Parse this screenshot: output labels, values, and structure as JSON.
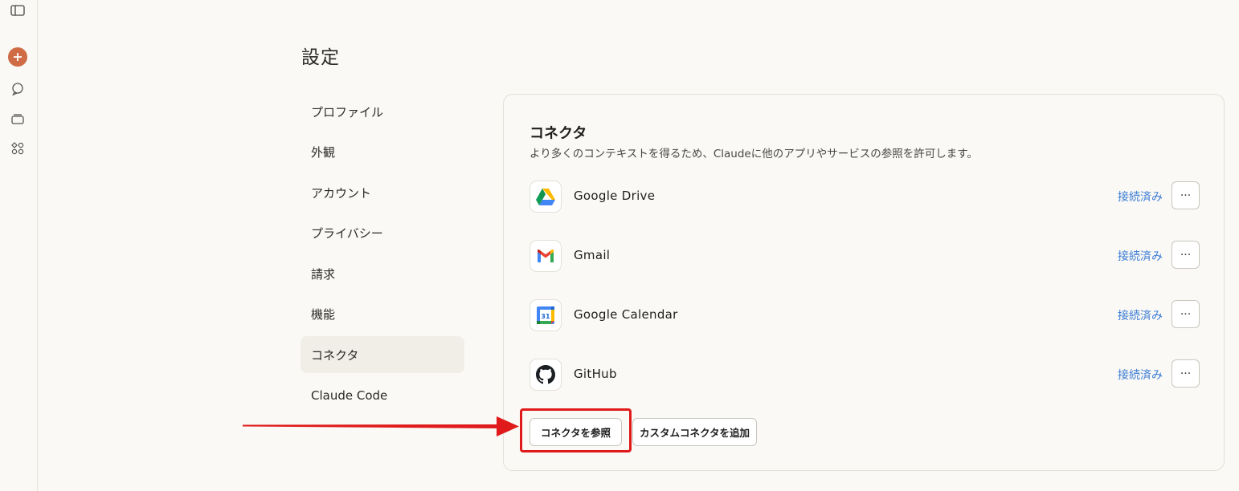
{
  "sidebar": {
    "icons": [
      "sidebar-toggle-icon",
      "new-chat-icon",
      "chats-icon",
      "projects-icon",
      "artifacts-icon"
    ],
    "accent": "#cf6b45"
  },
  "page": {
    "title": "設定"
  },
  "nav": {
    "items": [
      {
        "label": "プロファイル",
        "active": false
      },
      {
        "label": "外観",
        "active": false
      },
      {
        "label": "アカウント",
        "active": false
      },
      {
        "label": "プライバシー",
        "active": false
      },
      {
        "label": "請求",
        "active": false
      },
      {
        "label": "機能",
        "active": false
      },
      {
        "label": "コネクタ",
        "active": true
      },
      {
        "label": "Claude Code",
        "active": false
      }
    ]
  },
  "connectors": {
    "title": "コネクタ",
    "description": "より多くのコンテキストを得るため、Claudeに他のアプリやサービスの参照を許可します。",
    "items": [
      {
        "name": "Google Drive",
        "status": "接続済み",
        "more": "···",
        "icon": "google-drive-icon"
      },
      {
        "name": "Gmail",
        "status": "接続済み",
        "more": "···",
        "icon": "gmail-icon"
      },
      {
        "name": "Google Calendar",
        "status": "接続済み",
        "more": "···",
        "icon": "google-calendar-icon",
        "icon_text": "31"
      },
      {
        "name": "GitHub",
        "status": "接続済み",
        "more": "···",
        "icon": "github-icon"
      }
    ],
    "browse_button": "コネクタを参照",
    "add_custom_button": "カスタムコネクタを追加",
    "status_color": "#3a7bd5"
  },
  "annotation": {
    "highlight_color": "#e01a1a"
  }
}
